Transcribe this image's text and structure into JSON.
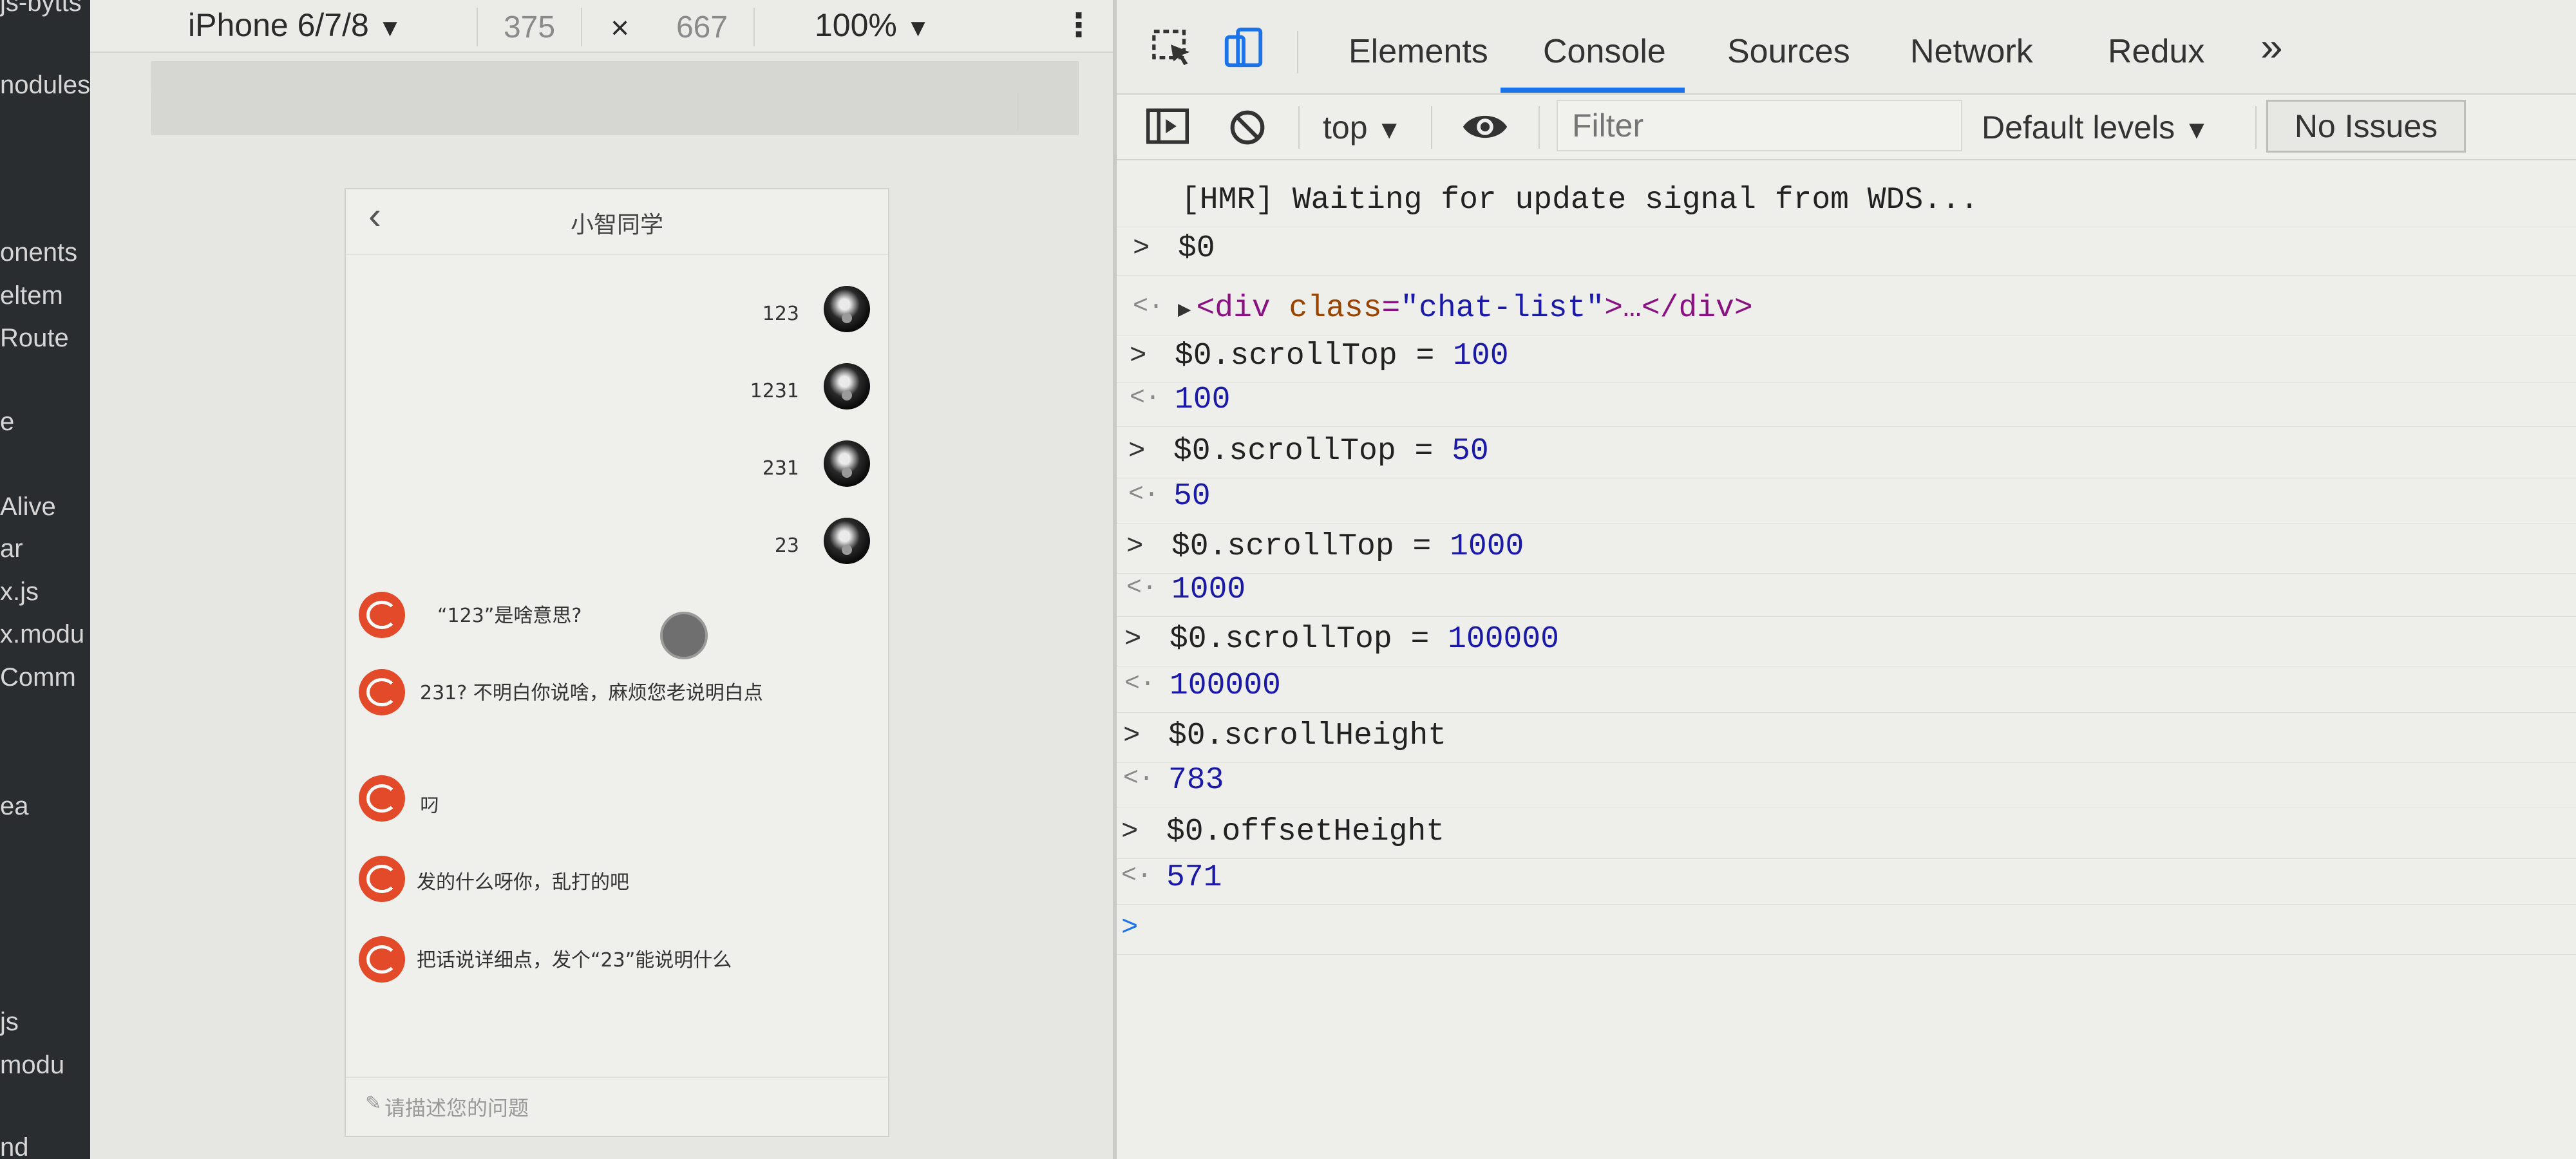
{
  "editor_sidebar": {
    "lines": [
      "js-bytts",
      "nodules",
      "onents",
      "eltem",
      "Route",
      "e",
      "Alive",
      "ar",
      "x.js",
      "x.modu",
      "Comm",
      "ea",
      "js",
      "modu",
      "nd"
    ]
  },
  "device_toolbar": {
    "device_name": "iPhone 6/7/8",
    "device_caret": "▼",
    "width": "375",
    "times": "×",
    "height": "667",
    "zoom": "100%",
    "zoom_caret": "▼",
    "more": "⋮"
  },
  "phone": {
    "back": "‹",
    "title": "小智同学",
    "right_messages": [
      "123",
      "1231",
      "231",
      "23"
    ],
    "left_messages": [
      "“123”是啥意思?",
      "231? 不明白你说啥，麻烦您老说明白点",
      "叼",
      "发的什么呀你，乱打的吧",
      "把话说详细点，发个“23”能说明什么"
    ],
    "input_placeholder": "请描述您的问题",
    "pencil": "✎"
  },
  "devtools": {
    "tabs": [
      "Elements",
      "Console",
      "Sources",
      "Network",
      "Redux"
    ],
    "active_tab": "Console",
    "more_tabs": "»",
    "accent_color": "#1a73e8",
    "console_toolbar": {
      "context": "top",
      "context_caret": "▼",
      "filter_placeholder": "Filter",
      "levels": "Default levels",
      "levels_caret": "▼",
      "issues": "No Issues"
    },
    "console_lines": [
      {
        "kind": "log",
        "prefix": "",
        "text": "[HMR] Waiting for update signal from WDS..."
      },
      {
        "kind": "input",
        "prefix": ">",
        "text": "$0"
      },
      {
        "kind": "output",
        "prefix": "<·",
        "text": "▶<div class=\"chat-list\">…</div>"
      },
      {
        "kind": "input",
        "prefix": ">",
        "text": "$0.scrollTop = 100"
      },
      {
        "kind": "output",
        "prefix": "<·",
        "text": "100"
      },
      {
        "kind": "input",
        "prefix": ">",
        "text": "$0.scrollTop = 50"
      },
      {
        "kind": "output",
        "prefix": "<·",
        "text": "50"
      },
      {
        "kind": "input",
        "prefix": ">",
        "text": "$0.scrollTop = 1000"
      },
      {
        "kind": "output",
        "prefix": "<·",
        "text": "1000"
      },
      {
        "kind": "input",
        "prefix": ">",
        "text": "$0.scrollTop = 100000"
      },
      {
        "kind": "output",
        "prefix": "<·",
        "text": "100000"
      },
      {
        "kind": "input",
        "prefix": ">",
        "text": "$0.scrollHeight"
      },
      {
        "kind": "output",
        "prefix": "<·",
        "text": "783"
      },
      {
        "kind": "input",
        "prefix": ">",
        "text": "$0.offsetHeight"
      },
      {
        "kind": "output",
        "prefix": "<·",
        "text": "571"
      },
      {
        "kind": "prompt",
        "prefix": ">",
        "text": ""
      }
    ]
  }
}
